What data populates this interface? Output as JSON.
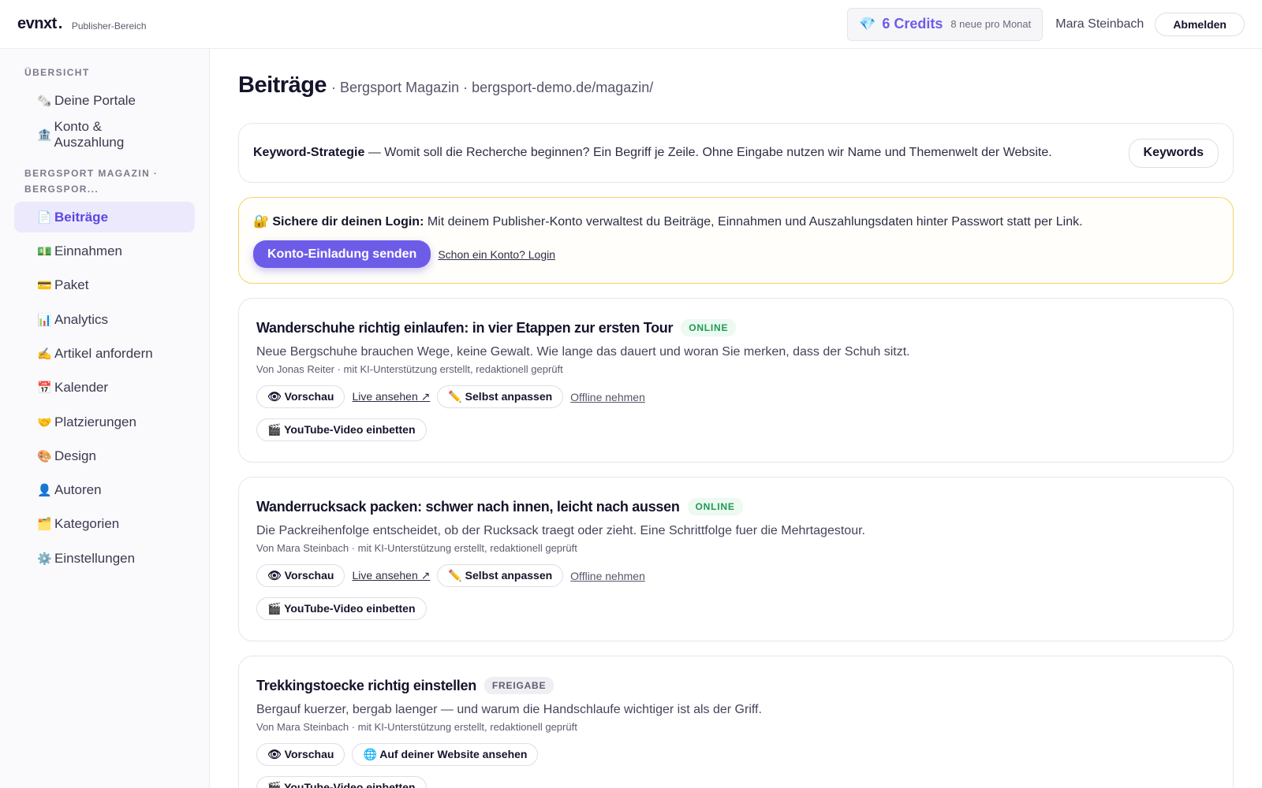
{
  "header": {
    "logo": "evnxt",
    "logo_dot": ".",
    "subtitle": "Publisher-Bereich",
    "credits_value": "6 Credits",
    "credits_note": "8 neue pro Monat",
    "user_name": "Mara Steinbach",
    "logout_label": "Abmelden"
  },
  "sidebar": {
    "section_overview": "ÜBERSICHT",
    "overview_items": [
      {
        "icon": "🗞️",
        "label": "Deine Portale"
      },
      {
        "icon": "🏦",
        "label": "Konto & Auszahlung"
      }
    ],
    "section_site": "BERGSPORT MAGAZIN · BERGSPOR...",
    "site_items": [
      {
        "icon": "📄",
        "label": "Beiträge",
        "active": true
      },
      {
        "icon": "💵",
        "label": "Einnahmen"
      },
      {
        "icon": "💳",
        "label": "Paket"
      },
      {
        "icon": "📊",
        "label": "Analytics"
      },
      {
        "icon": "✍️",
        "label": "Artikel anfordern"
      },
      {
        "icon": "📅",
        "label": "Kalender"
      },
      {
        "icon": "🤝",
        "label": "Platzierungen"
      },
      {
        "icon": "🎨",
        "label": "Design"
      },
      {
        "icon": "👤",
        "label": "Autoren"
      },
      {
        "icon": "🗂️",
        "label": "Kategorien"
      },
      {
        "icon": "⚙️",
        "label": "Einstellungen"
      }
    ]
  },
  "main": {
    "title": "Beiträge",
    "subtitle": "· Bergsport Magazin · bergsport-demo.de/magazin/",
    "keyword": {
      "label": "Keyword-Strategie",
      "text": " — Womit soll die Recherche beginnen? Ein Begriff je Zeile. Ohne Eingabe nutzen wir Name und Themenwelt der Website.",
      "button": "Keywords"
    },
    "login": {
      "icon": "🔐",
      "label": "Sichere dir deinen Login:",
      "text": " Mit deinem Publisher-Konto verwaltest du Beiträge, Einnahmen und Auszahlungsdaten hinter Passwort statt per Link.",
      "button": "Konto-Einladung senden",
      "link": "Schon ein Konto? Login"
    },
    "posts": [
      {
        "title": "Wanderschuhe richtig einlaufen: in vier Etappen zur ersten Tour",
        "status": "ONLINE",
        "desc": "Neue Bergschuhe brauchen Wege, keine Gewalt. Wie lange das dauert und woran Sie merken, dass der Schuh sitzt.",
        "meta": "Von Jonas Reiter · mit KI-Unterstützung erstellt, redaktionell geprüft",
        "preview": "👁 Vorschau",
        "live": "Live ansehen ↗",
        "edit": "✏️ Selbst anpassen",
        "offline": "Offline nehmen",
        "youtube": "🎬 YouTube-Video einbetten"
      },
      {
        "title": "Wanderrucksack packen: schwer nach innen, leicht nach aussen",
        "status": "ONLINE",
        "desc": "Die Packreihenfolge entscheidet, ob der Rucksack traegt oder zieht. Eine Schrittfolge fuer die Mehrtagestour.",
        "meta": "Von Mara Steinbach · mit KI-Unterstützung erstellt, redaktionell geprüft",
        "preview": "👁 Vorschau",
        "live": "Live ansehen ↗",
        "edit": "✏️ Selbst anpassen",
        "offline": "Offline nehmen",
        "youtube": "🎬 YouTube-Video einbetten"
      },
      {
        "title": "Trekkingstoecke richtig einstellen",
        "status": "FREIGABE",
        "desc": "Bergauf kuerzer, bergab laenger — und warum die Handschlaufe wichtiger ist als der Griff.",
        "meta": "Von Mara Steinbach · mit KI-Unterstützung erstellt, redaktionell geprüft",
        "preview": "👁 Vorschau",
        "website": "🌐 Auf deiner Website ansehen",
        "youtube": "🎬 YouTube-Video einbetten"
      }
    ]
  }
}
